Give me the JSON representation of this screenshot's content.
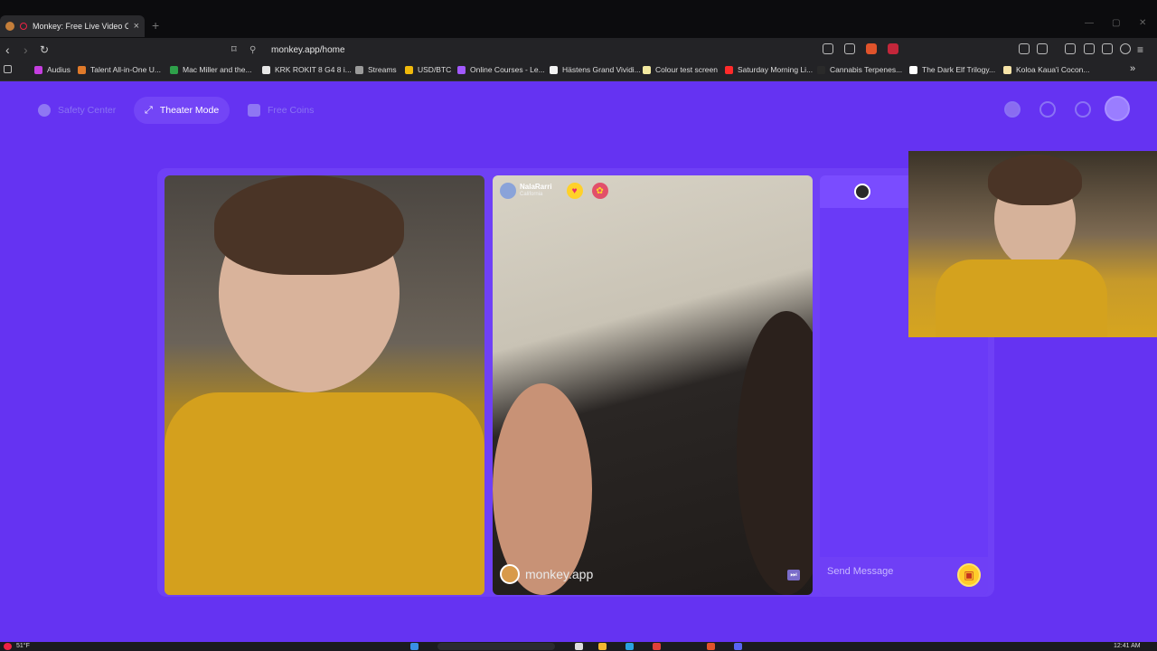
{
  "browser": {
    "tab_title": "Monkey: Free Live Video Chat",
    "tab_close": "×",
    "new_tab": "+",
    "url": "monkey.app/home",
    "bookmarks": [
      {
        "label": "Audius",
        "color": "#c43ee0"
      },
      {
        "label": "Talent All-in-One U...",
        "color": "#e07a2a"
      },
      {
        "label": "Mac Miller and the...",
        "color": "#2ea04a"
      },
      {
        "label": "KRK ROKIT 8 G4 8 i...",
        "color": "#e6e6e6"
      },
      {
        "label": "Streams",
        "color": "#9a9a9a"
      },
      {
        "label": "USD/BTC",
        "color": "#f0b90b"
      },
      {
        "label": "Online Courses - Le...",
        "color": "#a259ff"
      },
      {
        "label": "Hästens Grand Vividi...",
        "color": "#f2f2f2"
      },
      {
        "label": "Colour test screen",
        "color": "#f2e8a0"
      },
      {
        "label": "Saturday Morning Li...",
        "color": "#ff2a2a"
      },
      {
        "label": "Cannabis Terpenes...",
        "color": "#2a2a2a"
      },
      {
        "label": "The Dark Elf Trilogy...",
        "color": "#ffffff"
      },
      {
        "label": "Koloa Kaua'i Cocon...",
        "color": "#f6e3a8"
      }
    ],
    "more_bookmarks": "»"
  },
  "nav": {
    "safety_center": "Safety Center",
    "theater_mode": "Theater Mode",
    "free_coins": "Free Coins"
  },
  "partner": {
    "name": "NalaRarri",
    "location": "California",
    "watermark": "monkey.app"
  },
  "chat": {
    "placeholder": "Send Message"
  },
  "taskbar": {
    "weather": "51°F",
    "clock": "12:41 AM"
  },
  "colors": {
    "page_bg": "#6533f2",
    "accent": "#7a4cff",
    "gift": "#ffcc2a"
  }
}
